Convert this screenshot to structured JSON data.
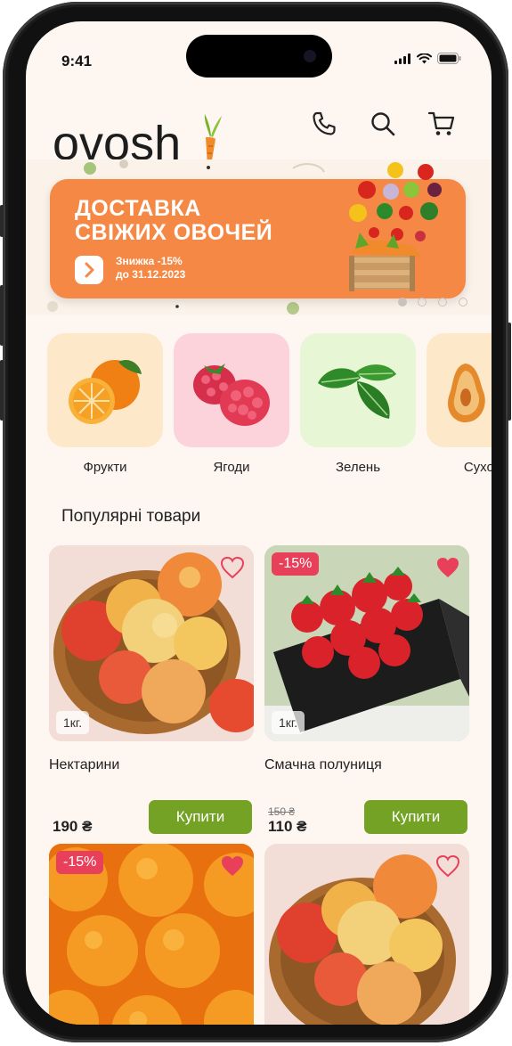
{
  "status_bar": {
    "time": "9:41"
  },
  "header": {
    "logo_text": "ovosh",
    "icons": [
      "phone-icon",
      "search-icon",
      "cart-icon"
    ]
  },
  "banner": {
    "title_line1": "ДОСТАВКА",
    "title_line2": "СВІЖИХ ОВОЧЕЙ",
    "discount_line": "Знижка -15%",
    "date_line": "до 31.12.2023",
    "button_icon": "chevron-right-icon",
    "pagination": {
      "total": 4,
      "active": 1
    },
    "color": "#f58845"
  },
  "categories": [
    {
      "label": "Фрукти",
      "icon": "orange-icon",
      "bg": "#fde8c9"
    },
    {
      "label": "Ягоди",
      "icon": "raspberry-icon",
      "bg": "#fcd3da"
    },
    {
      "label": "Зелень",
      "icon": "basil-icon",
      "bg": "#e7f7d6"
    },
    {
      "label": "Сухоф",
      "icon": "dried-pear-icon",
      "bg": "#fde8c9"
    }
  ],
  "section": {
    "title": "Популярні товари"
  },
  "products": [
    {
      "name": "Нектарини",
      "weight": "1кг.",
      "price": "190 ₴",
      "old_price": "",
      "discount": "",
      "favorite": false,
      "buy_label": "Купити",
      "image": "nectarines"
    },
    {
      "name": "Смачна полуниця",
      "weight": "1кг.",
      "price": "110 ₴",
      "old_price": "150 ₴",
      "discount": "-15%",
      "favorite": true,
      "buy_label": "Купити",
      "image": "strawberries"
    },
    {
      "name": "",
      "weight": "",
      "price": "",
      "old_price": "",
      "discount": "-15%",
      "favorite": true,
      "buy_label": "",
      "image": "tangerines"
    },
    {
      "name": "",
      "weight": "",
      "price": "",
      "old_price": "",
      "discount": "",
      "favorite": false,
      "buy_label": "",
      "image": "nectarines"
    }
  ],
  "colors": {
    "accent": "#74a224",
    "discount": "#e8405b",
    "background": "#fdf6f1"
  }
}
